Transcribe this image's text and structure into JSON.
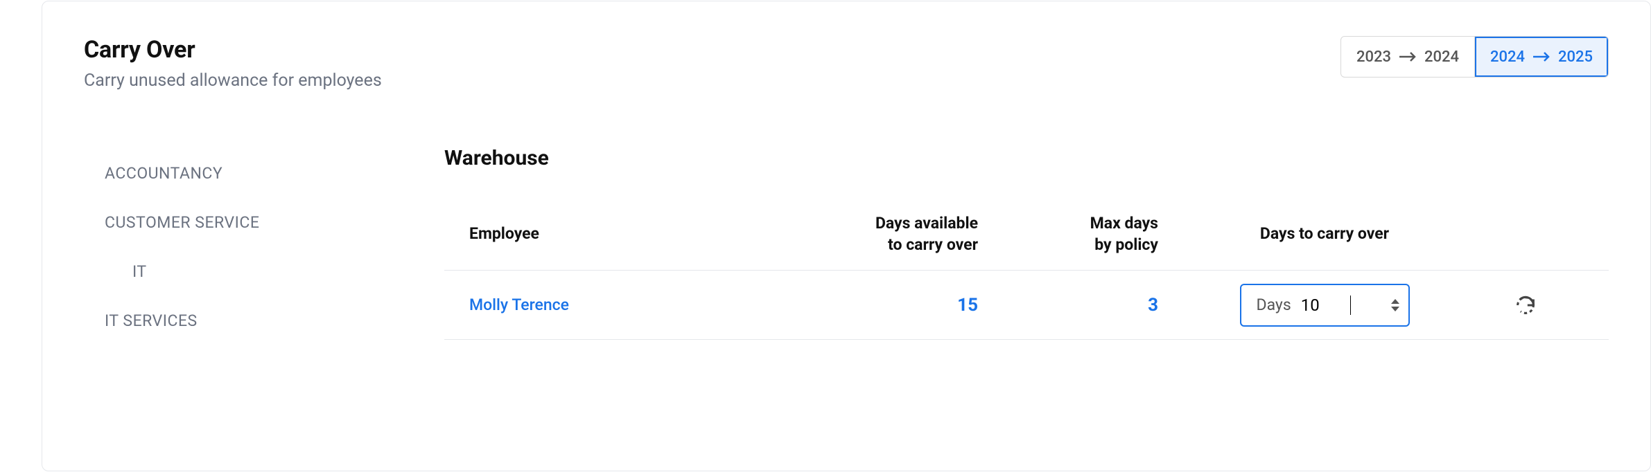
{
  "header": {
    "title": "Carry Over",
    "subtitle": "Carry unused allowance for employees"
  },
  "year_tabs": [
    {
      "from": "2023",
      "to": "2024",
      "active": false
    },
    {
      "from": "2024",
      "to": "2025",
      "active": true
    }
  ],
  "sidebar": {
    "items": [
      {
        "label": "ACCOUNTANCY",
        "indent": false
      },
      {
        "label": "CUSTOMER SERVICE",
        "indent": false
      },
      {
        "label": "IT",
        "indent": true
      },
      {
        "label": "IT SERVICES",
        "indent": false
      }
    ]
  },
  "main": {
    "section_title": "Warehouse",
    "columns": {
      "employee": "Employee",
      "available_l1": "Days available",
      "available_l2": "to carry over",
      "maxpolicy_l1": "Max days",
      "maxpolicy_l2": "by policy",
      "carry": "Days to carry over"
    },
    "rows": [
      {
        "employee": "Molly Terence",
        "days_available": "15",
        "max_days_policy": "3",
        "input_label": "Days",
        "input_value": "10"
      }
    ]
  }
}
